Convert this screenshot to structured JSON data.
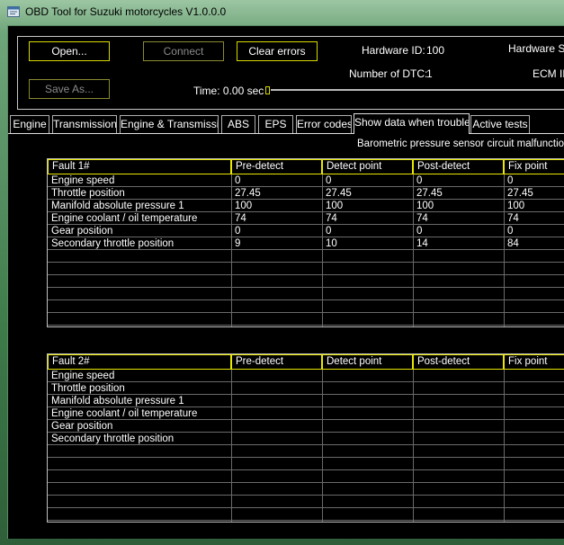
{
  "window": {
    "title": "OBD Tool for Suzuki motorcycles V1.0.0.0"
  },
  "toolbar": {
    "open_label": "Open...",
    "connect_label": "Connect",
    "clear_errors_label": "Clear errors",
    "save_as_label": "Save As..."
  },
  "info": {
    "hardware_id_label": "Hardware ID:",
    "hardware_id_value": "100",
    "hardware_sn_label": "Hardware SN",
    "dtc_label": "Number of DTC:",
    "dtc_value": "1",
    "ecm_label": "ECM ID",
    "time_label": "Time: 0.00 sec"
  },
  "tabs": [
    {
      "label": "Engine"
    },
    {
      "label": "Transmission"
    },
    {
      "label": "Engine & Transmission"
    },
    {
      "label": "ABS"
    },
    {
      "label": "EPS"
    },
    {
      "label": "Error codes"
    },
    {
      "label": "Show data when trouble"
    },
    {
      "label": "Active tests"
    }
  ],
  "trouble_title": "Barometric pressure sensor circuit malfunction",
  "fault1": {
    "headers": [
      "Fault 1#",
      "Pre-detect",
      "Detect point",
      "Post-detect",
      "Fix point"
    ],
    "rows": [
      [
        "Engine speed",
        "0",
        "0",
        "0",
        "0"
      ],
      [
        "Throttle position",
        "27.45",
        "27.45",
        "27.45",
        "27.45"
      ],
      [
        "Manifold absolute pressure 1",
        "100",
        "100",
        "100",
        "100"
      ],
      [
        "Engine coolant / oil temperature",
        "74",
        "74",
        "74",
        "74"
      ],
      [
        "Gear position",
        "0",
        "0",
        "0",
        "0"
      ],
      [
        "Secondary throttle position",
        "9",
        "10",
        "14",
        "84"
      ]
    ]
  },
  "fault2": {
    "headers": [
      "Fault 2#",
      "Pre-detect",
      "Detect point",
      "Post-detect",
      "Fix point"
    ],
    "rows": [
      [
        "Engine speed",
        "",
        "",
        "",
        ""
      ],
      [
        "Throttle position",
        "",
        "",
        "",
        ""
      ],
      [
        "Manifold absolute pressure 1",
        "",
        "",
        "",
        ""
      ],
      [
        "Engine coolant / oil temperature",
        "",
        "",
        "",
        ""
      ],
      [
        "Gear position",
        "",
        "",
        "",
        ""
      ],
      [
        "Secondary throttle position",
        "",
        "",
        "",
        ""
      ]
    ]
  }
}
